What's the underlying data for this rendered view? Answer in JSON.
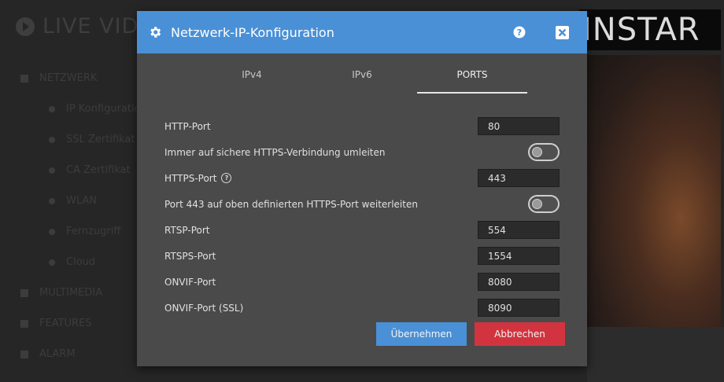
{
  "background": {
    "app_title": "LIVE VIDEO",
    "logo_text": "INSTAR",
    "nav": [
      {
        "label": "NETZWERK",
        "level": "top"
      },
      {
        "label": "IP Konfiguration",
        "level": "sub"
      },
      {
        "label": "SSL Zertifikat",
        "level": "sub"
      },
      {
        "label": "CA Zertifikat",
        "level": "sub"
      },
      {
        "label": "WLAN",
        "level": "sub"
      },
      {
        "label": "Fernzugriff",
        "level": "sub"
      },
      {
        "label": "Cloud",
        "level": "sub"
      },
      {
        "label": "MULTIMEDIA",
        "level": "top"
      },
      {
        "label": "FEATURES",
        "level": "top"
      },
      {
        "label": "ALARM",
        "level": "top"
      }
    ]
  },
  "modal": {
    "title": "Netzwerk-IP-Konfiguration",
    "help_icon": "question-circle-icon",
    "close_icon": "close-icon",
    "tabs": [
      {
        "label": "IPv4",
        "active": false
      },
      {
        "label": "IPv6",
        "active": false
      },
      {
        "label": "PORTS",
        "active": true
      }
    ],
    "fields": [
      {
        "label": "HTTP-Port",
        "type": "input",
        "value": "80"
      },
      {
        "label": "Immer auf sichere HTTPS-Verbindung umleiten",
        "type": "toggle",
        "value": "off"
      },
      {
        "label": "HTTPS-Port",
        "type": "input",
        "value": "443",
        "help": true
      },
      {
        "label": "Port 443 auf oben definierten HTTPS-Port weiterleiten",
        "type": "toggle",
        "value": "off"
      },
      {
        "label": "RTSP-Port",
        "type": "input",
        "value": "554"
      },
      {
        "label": "RTSPS-Port",
        "type": "input",
        "value": "1554"
      },
      {
        "label": "ONVIF-Port",
        "type": "input",
        "value": "8080"
      },
      {
        "label": "ONVIF-Port (SSL)",
        "type": "input",
        "value": "8090"
      }
    ],
    "apply_label": "Übernehmen",
    "cancel_label": "Abbrechen"
  },
  "colors": {
    "accent": "#4a90d6",
    "danger": "#d1343f",
    "modal_bg": "#4a4a4a"
  }
}
